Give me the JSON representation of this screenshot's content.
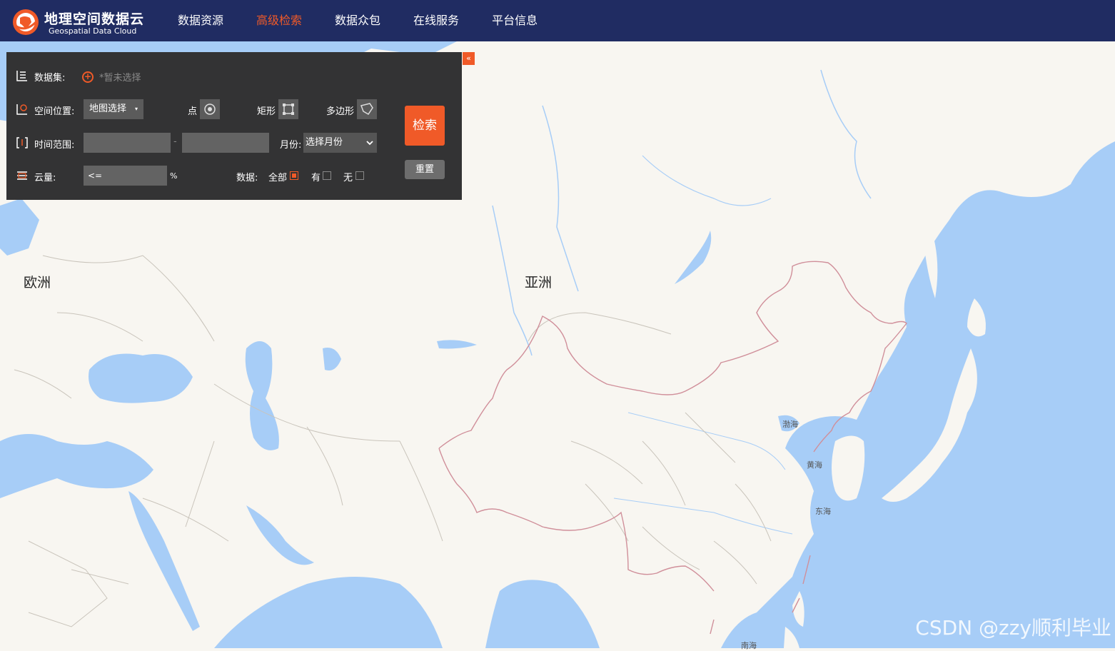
{
  "header": {
    "logo_title": "地理空间数据云",
    "logo_subtitle": "Geospatial Data Cloud",
    "nav": [
      {
        "label": "数据资源"
      },
      {
        "label": "高级检索"
      },
      {
        "label": "数据众包"
      },
      {
        "label": "在线服务"
      },
      {
        "label": "平台信息"
      }
    ],
    "active_index": 1
  },
  "panel": {
    "collapse_label": "«",
    "dataset_label": "数据集:",
    "dataset_hint": "*暂未选择",
    "location_label": "空间位置:",
    "location_select": "地图选择",
    "point_label": "点",
    "rect_label": "矩形",
    "polygon_label": "多边形",
    "time_label": "时间范围:",
    "time_start": "",
    "time_end": "",
    "time_sep": "-",
    "month_label": "月份:",
    "month_select": "选择月份",
    "cloud_label": "云量:",
    "cloud_op": "<=",
    "cloud_unit": "%",
    "data_label": "数据:",
    "data_all": "全部",
    "data_yes": "有",
    "data_no": "无",
    "search_button": "检索",
    "reset_button": "重置"
  },
  "map": {
    "labels": {
      "europe": "欧洲",
      "asia": "亚洲",
      "bohai": "渤海",
      "yellow_sea": "黄海",
      "east_sea": "东海",
      "south_sea": "南海"
    }
  },
  "watermark": "CSDN @zzy顺利毕业",
  "colors": {
    "nav_bg": "#202c62",
    "accent": "#f05a28",
    "land": "#f8f6f1",
    "water": "#a7cdf7",
    "border": "#d08f9a"
  }
}
